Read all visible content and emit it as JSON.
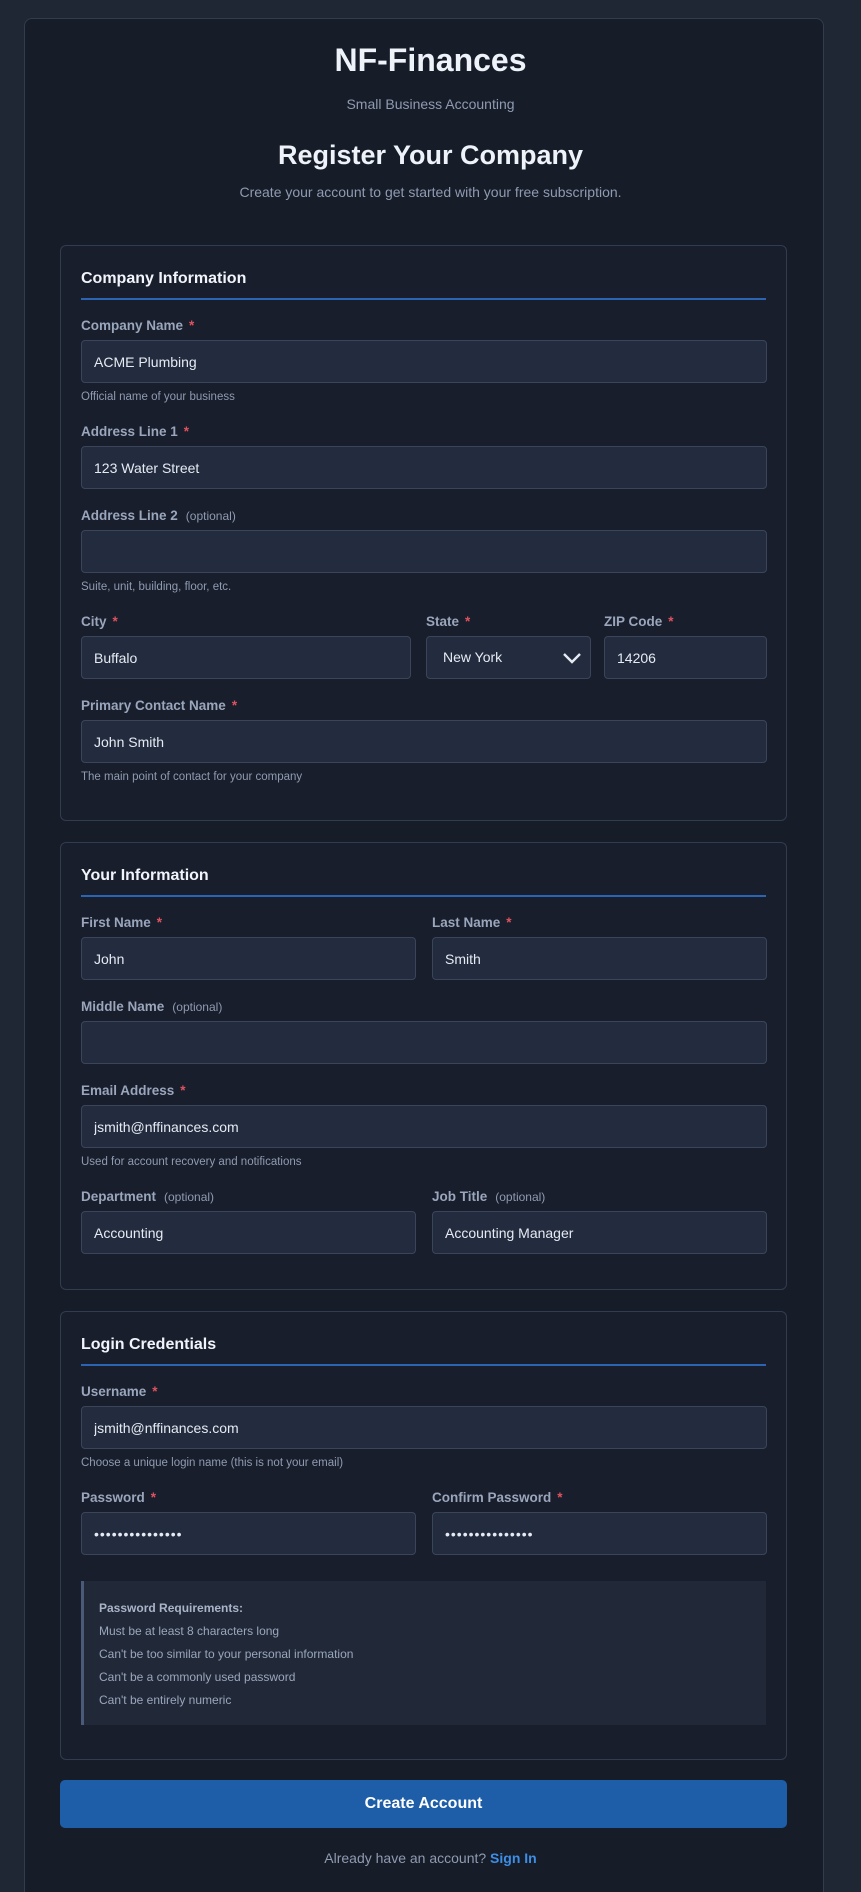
{
  "brand": {
    "title": "NF-Finances",
    "subtitle": "Small Business Accounting"
  },
  "page": {
    "title": "Register Your Company",
    "subtitle": "Create your account to get started with your free subscription."
  },
  "company": {
    "title": "Company Information",
    "company_name": {
      "label": "Company Name",
      "value": "ACME Plumbing",
      "help": "Official name of your business"
    },
    "address1": {
      "label": "Address Line 1",
      "value": "123 Water Street"
    },
    "address2": {
      "label": "Address Line 2",
      "optional": "(optional)",
      "value": "",
      "help": "Suite, unit, building, floor, etc."
    },
    "city": {
      "label": "City",
      "value": "Buffalo"
    },
    "state": {
      "label": "State",
      "value": "New York"
    },
    "zip": {
      "label": "ZIP Code",
      "value": "14206"
    },
    "contact": {
      "label": "Primary Contact Name",
      "value": "John Smith",
      "help": "The main point of contact for your company"
    }
  },
  "user": {
    "title": "Your Information",
    "first_name": {
      "label": "First Name",
      "value": "John"
    },
    "last_name": {
      "label": "Last Name",
      "value": "Smith"
    },
    "middle_name": {
      "label": "Middle Name",
      "optional": "(optional)",
      "value": ""
    },
    "email": {
      "label": "Email Address",
      "value": "jsmith@nffinances.com",
      "help": "Used for account recovery and notifications"
    },
    "department": {
      "label": "Department",
      "optional": "(optional)",
      "value": "Accounting"
    },
    "job_title": {
      "label": "Job Title",
      "optional": "(optional)",
      "value": "Accounting Manager"
    }
  },
  "login": {
    "title": "Login Credentials",
    "username": {
      "label": "Username",
      "value": "jsmith@nffinances.com",
      "help": "Choose a unique login name (this is not your email)"
    },
    "password": {
      "label": "Password",
      "value": "•••••••••••••••"
    },
    "confirm": {
      "label": "Confirm Password",
      "value": "•••••••••••••••"
    },
    "requirements": {
      "title": "Password Requirements:",
      "items": [
        "Must be at least 8 characters long",
        "Can't be too similar to your personal information",
        "Can't be a commonly used password",
        "Can't be entirely numeric"
      ]
    }
  },
  "actions": {
    "submit": "Create Account",
    "signin_prompt": "Already have an account?",
    "signin_link": "Sign In"
  },
  "required_marker": "*",
  "colors": {
    "accent": "#1e5ea8",
    "link": "#3d8ee6",
    "required": "#e05260"
  }
}
